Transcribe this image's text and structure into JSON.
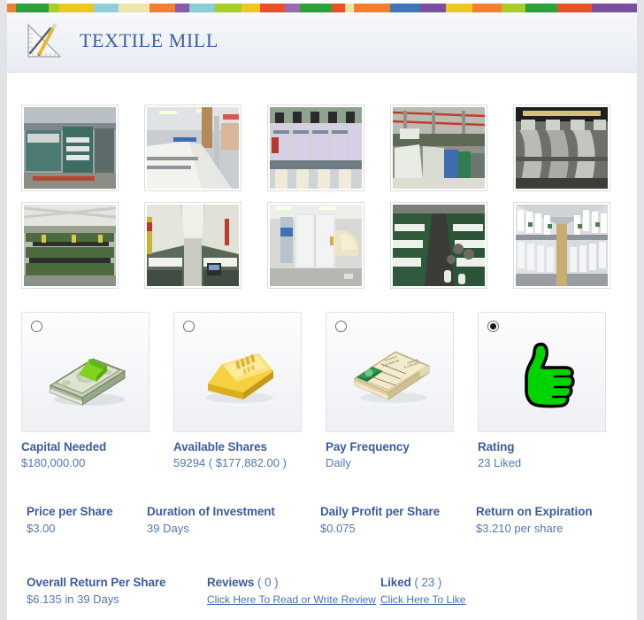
{
  "header": {
    "title": "TEXTILE MILL",
    "logo_icon": "ruler-pencil-icon"
  },
  "stripe_colors": [
    "#f08030",
    "#2aa13a",
    "#a8cc2a",
    "#edc820",
    "#8fd0d8",
    "#ede6a8",
    "#f08030",
    "#8a5aa8",
    "#87ced6",
    "#a8cc2a",
    "#edc820",
    "#e8502a",
    "#9a6ab0",
    "#2aa13a",
    "#e8502a",
    "#ede6a8",
    "#f08030",
    "#3f77b5",
    "#7a4fa0",
    "#edc820",
    "#f08030",
    "#a8cc2a",
    "#2aa13a",
    "#e8502a"
  ],
  "gallery": {
    "rows": [
      [
        {
          "alt": "textile-finishing-machine"
        },
        {
          "alt": "cotton-conveyor-line"
        },
        {
          "alt": "spinning-frame-bobbins"
        },
        {
          "alt": "raw-cotton-bales-warehouse"
        },
        {
          "alt": "carding-machine-rollers"
        }
      ],
      [
        {
          "alt": "weaving-loom-hall"
        },
        {
          "alt": "loom-aisle-warp-sheets"
        },
        {
          "alt": "blow-room-cotton-opener"
        },
        {
          "alt": "green-weaving-looms-rows"
        },
        {
          "alt": "ring-spinning-machine-aisle"
        }
      ]
    ]
  },
  "options": [
    {
      "id": "capital-needed",
      "icon": "cash-stack-icon",
      "selected": false,
      "label": "Capital Needed",
      "value": "$180,000.00"
    },
    {
      "id": "available-shares",
      "icon": "gold-bar-icon",
      "selected": false,
      "label": "Available Shares",
      "value": "59294 ( $177,882.00 )"
    },
    {
      "id": "pay-frequency",
      "icon": "cheque-book-icon",
      "selected": false,
      "label": "Pay Frequency",
      "value": "Daily"
    },
    {
      "id": "rating",
      "icon": "thumbs-up-icon",
      "selected": true,
      "label": "Rating",
      "value": "23 Liked"
    }
  ],
  "stats_row_1": [
    {
      "label": "Price per Share",
      "value": "$3.00"
    },
    {
      "label": "Duration of Investment",
      "value": "39 Days"
    },
    {
      "label": "Daily Profit per Share",
      "value": "$0.075"
    },
    {
      "label": "Return on Expiration",
      "value": "$3.210 per share"
    }
  ],
  "stats_row_2": [
    {
      "label": "Overall Return Per Share",
      "count": "",
      "value": "$6.135 in 39 Days",
      "link": ""
    },
    {
      "label": "Reviews",
      "count": " ( 0 )",
      "value": "",
      "link": "Click Here To Read or Write Review"
    },
    {
      "label": "Liked",
      "count": " ( 23 )",
      "value": "",
      "link": "Click Here To Like"
    }
  ],
  "colors": {
    "label_blue": "#3b5c9e",
    "value_blue": "#5277b3",
    "brand_blue": "#40609e",
    "gutter_grey": "#e1e3e6"
  }
}
